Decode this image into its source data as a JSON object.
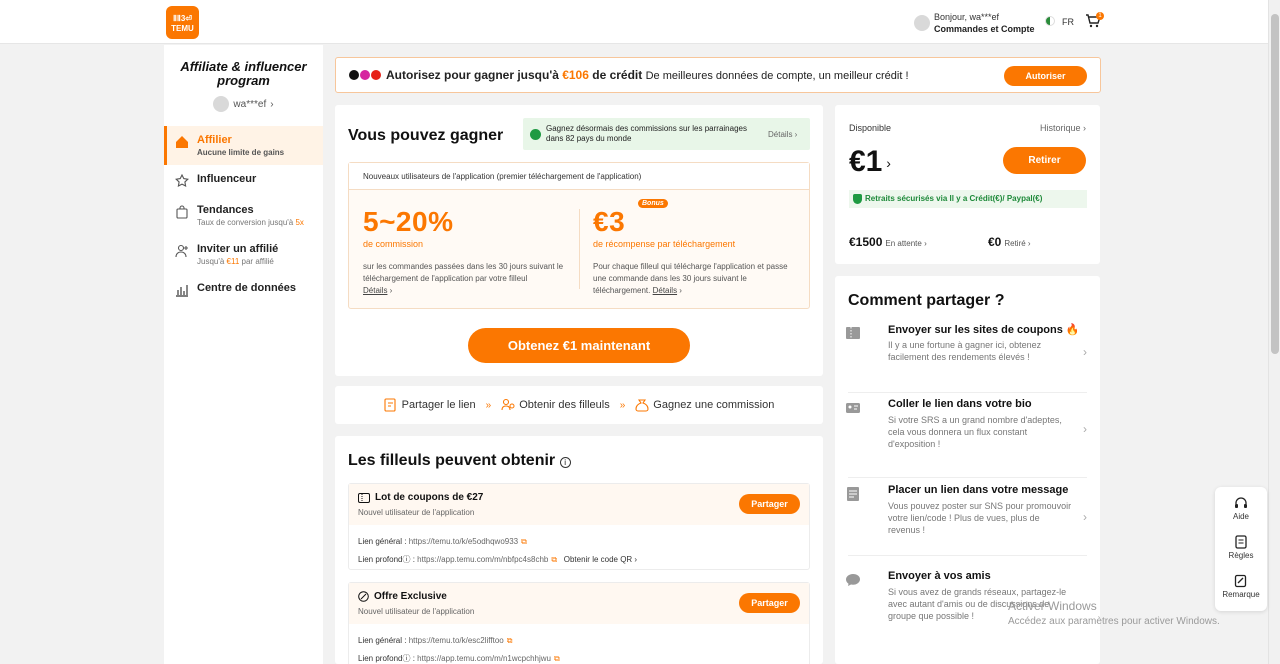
{
  "header": {
    "logo_line1": "ⅡⅡ3⏎",
    "logo_line2": "TEMU",
    "greeting": "Bonjour, wa***ef",
    "account_link": "Commandes et Compte",
    "language": "FR",
    "cart_count": "1"
  },
  "sidebar": {
    "program_title_1": "Affiliate & influencer",
    "program_title_2": "program",
    "username": "wa***ef",
    "items": [
      {
        "label": "Affilier",
        "sub": "Aucune limite de gains"
      },
      {
        "label": "Influenceur",
        "sub": ""
      },
      {
        "label": "Tendances",
        "sub_pre": "Taux de conversion jusqu'à ",
        "sub_hl": "5x"
      },
      {
        "label": "Inviter un affilié",
        "sub_pre": "Jusqu'à ",
        "sub_hl": "€11",
        "sub_post": " par affilié"
      },
      {
        "label": "Centre de données",
        "sub": ""
      }
    ]
  },
  "banner": {
    "text_pre": "Autorisez pour gagner jusqu'à ",
    "amount": "€106",
    "text_post": " de crédit ",
    "text_normal": "De meilleures données de compte, un meilleur crédit !",
    "button": "Autoriser"
  },
  "earn": {
    "title": "Vous pouvez gagner",
    "note": "Gagnez désormais des commissions sur les parrainages dans 82 pays du monde",
    "note_link": "Détails ›",
    "box_header": "Nouveaux utilisateurs de l'application (premier téléchargement de l'application)",
    "commission_value": "5~20%",
    "commission_label": "de commission",
    "commission_desc": "sur les commandes passées dans les 30 jours suivant le téléchargement de l'application par votre filleul",
    "commission_link": "Détails",
    "reward_value": "€3",
    "bonus_tag": "Bonus",
    "reward_label": "de récompense par téléchargement",
    "reward_desc": "Pour chaque filleul qui télécharge l'application et passe une commande dans les 30 jours suivant le téléchargement.",
    "reward_link": "Détails",
    "cta": "Obtenez €1 maintenant"
  },
  "steps": {
    "step1": "Partager le lien",
    "step2": "Obtenir des filleuls",
    "step3": "Gagnez une commission",
    "arrow": "»"
  },
  "referrals": {
    "title": "Les filleuls peuvent obtenir",
    "coupons": [
      {
        "name": "Lot de coupons de €27",
        "sub": "Nouvel utilisateur de l'application",
        "button": "Partager",
        "general_label": "Lien général :",
        "general_url": "https://temu.to/k/e5odhqwo933",
        "deep_label": "Lien profond",
        "deep_url": "https://app.temu.com/m/nbfpc4s8chb",
        "qr": "Obtenir le code QR ›"
      },
      {
        "name": "Offre Exclusive",
        "sub": "Nouvel utilisateur de l'application",
        "button": "Partager",
        "general_label": "Lien général :",
        "general_url": "https://temu.to/k/esc2lifftoo",
        "deep_label": "Lien profond",
        "deep_url": "https://app.temu.com/m/n1wcpchhjwu"
      }
    ]
  },
  "balance": {
    "label": "Disponible",
    "history": "Historique ›",
    "amount": "€1",
    "button": "Retirer",
    "secure": "Retraits sécurisés via  Il y a Crédit(€)/  Paypal(€)",
    "pending_amount": "€1500",
    "pending_label": "En attente ›",
    "withdrawn_amount": "€0",
    "withdrawn_label": "Retiré ›"
  },
  "share": {
    "title": "Comment partager ?",
    "items": [
      {
        "title": "Envoyer sur les sites de coupons",
        "desc": "Il y a une fortune à gagner ici, obtenez facilement des rendements élevés !"
      },
      {
        "title": "Coller le lien dans votre bio",
        "desc": "Si votre SRS a un grand nombre d'adeptes, cela vous donnera un flux constant d'exposition !"
      },
      {
        "title": "Placer un lien dans votre message",
        "desc": "Vous pouvez poster sur SNS pour promouvoir votre lien/code ! Plus de vues, plus de revenus !"
      },
      {
        "title": "Envoyer à vos amis",
        "desc": "Si vous avez de grands réseaux, partagez-le avec autant d'amis ou de discussions de groupe que possible !"
      }
    ]
  },
  "help": {
    "aide": "Aide",
    "regles": "Règles",
    "remarque": "Remarque"
  },
  "watermark": {
    "line1": "Activer Windows",
    "line2": "Accédez aux paramètres pour activer Windows."
  },
  "colors": {
    "accent": "#fb7701",
    "success": "#1e9a42"
  }
}
